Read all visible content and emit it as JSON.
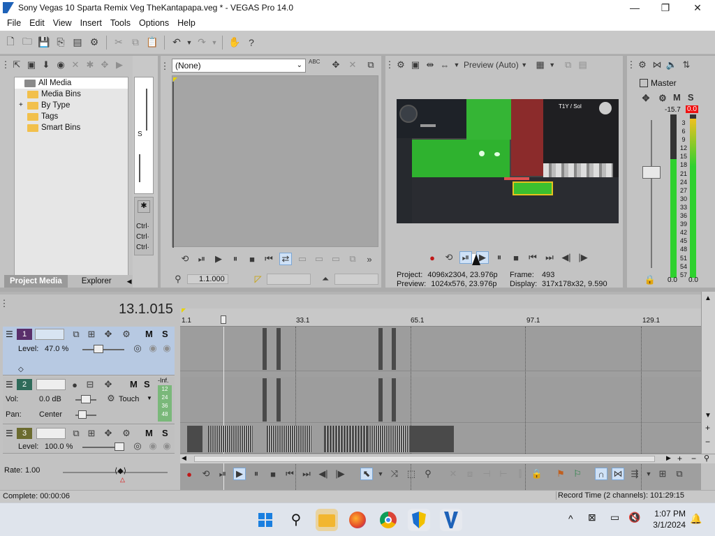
{
  "window": {
    "title": "Sony Vegas 10 Sparta Remix Veg TheKantapapa.veg * - VEGAS Pro 14.0",
    "minimize": "—",
    "maximize": "❐",
    "close": "✕"
  },
  "menu": [
    "File",
    "Edit",
    "View",
    "Insert",
    "Tools",
    "Options",
    "Help"
  ],
  "project_media": {
    "tree": [
      {
        "label": "All Media",
        "selected": true,
        "expand": ""
      },
      {
        "label": "Media Bins",
        "selected": false,
        "expand": ""
      },
      {
        "label": "By Type",
        "selected": false,
        "expand": "+"
      },
      {
        "label": "Tags",
        "selected": false,
        "expand": ""
      },
      {
        "label": "Smart Bins",
        "selected": false,
        "expand": ""
      }
    ],
    "tabs": [
      "Project Media",
      "Explorer"
    ],
    "side_letter": "S",
    "ctrl": [
      "Ctrl·",
      "Ctrl·",
      "Ctrl·"
    ]
  },
  "trimmer": {
    "dropdown": "(None)",
    "abc": "ABC",
    "time": "1.1.000"
  },
  "preview": {
    "mode": "Preview (Auto)",
    "overlay_text": "T1Y / Sol",
    "project_label": "Project:",
    "project_value": "4096x2304, 23.976p",
    "preview_label": "Preview:",
    "preview_value": "1024x576, 23.976p",
    "frame_label": "Frame:",
    "frame_value": "493",
    "display_label": "Display:",
    "display_value": "317x178x32, 9.590"
  },
  "master": {
    "title": "Master",
    "m": "M",
    "s": "S",
    "db_left": "-15.7",
    "db_right": "0.0",
    "scale": [
      "3",
      "6",
      "9",
      "12",
      "15",
      "18",
      "21",
      "24",
      "27",
      "30",
      "33",
      "36",
      "39",
      "42",
      "45",
      "48",
      "51",
      "54",
      "57"
    ],
    "bottom_left": "0.0",
    "bottom_right": "0.0"
  },
  "timeline": {
    "timecode": "13.1.015",
    "ruler": [
      "1.1",
      "33.1",
      "65.1",
      "97.1",
      "129.1"
    ],
    "tracks": [
      {
        "num": "1",
        "m": "M",
        "s": "S",
        "level_label": "Level:",
        "level_value": "47.0 %"
      },
      {
        "num": "2",
        "m": "M",
        "s": "S",
        "inf": "-Inf.",
        "vol_label": "Vol:",
        "vol_value": "0.0 dB",
        "touch": "Touch",
        "pan_label": "Pan:",
        "pan_value": "Center",
        "mini_scale": [
          "12",
          "24",
          "36",
          "48"
        ]
      },
      {
        "num": "3",
        "m": "M",
        "s": "S",
        "level_label": "Level:",
        "level_value": "100.0 %"
      }
    ],
    "rate_label": "Rate:",
    "rate_value": "1.00"
  },
  "status": {
    "complete": "Complete: 00:00:06",
    "record": "Record Time (2 channels): 101:29:15"
  },
  "taskbar": {
    "time": "1:07 PM",
    "date": "3/1/2024",
    "chevron": "^"
  },
  "colors": {
    "accent": "#1e62b8",
    "green_screen": "#2eb82e",
    "meter_green": "#2fd12f",
    "meter_red": "#e11"
  }
}
